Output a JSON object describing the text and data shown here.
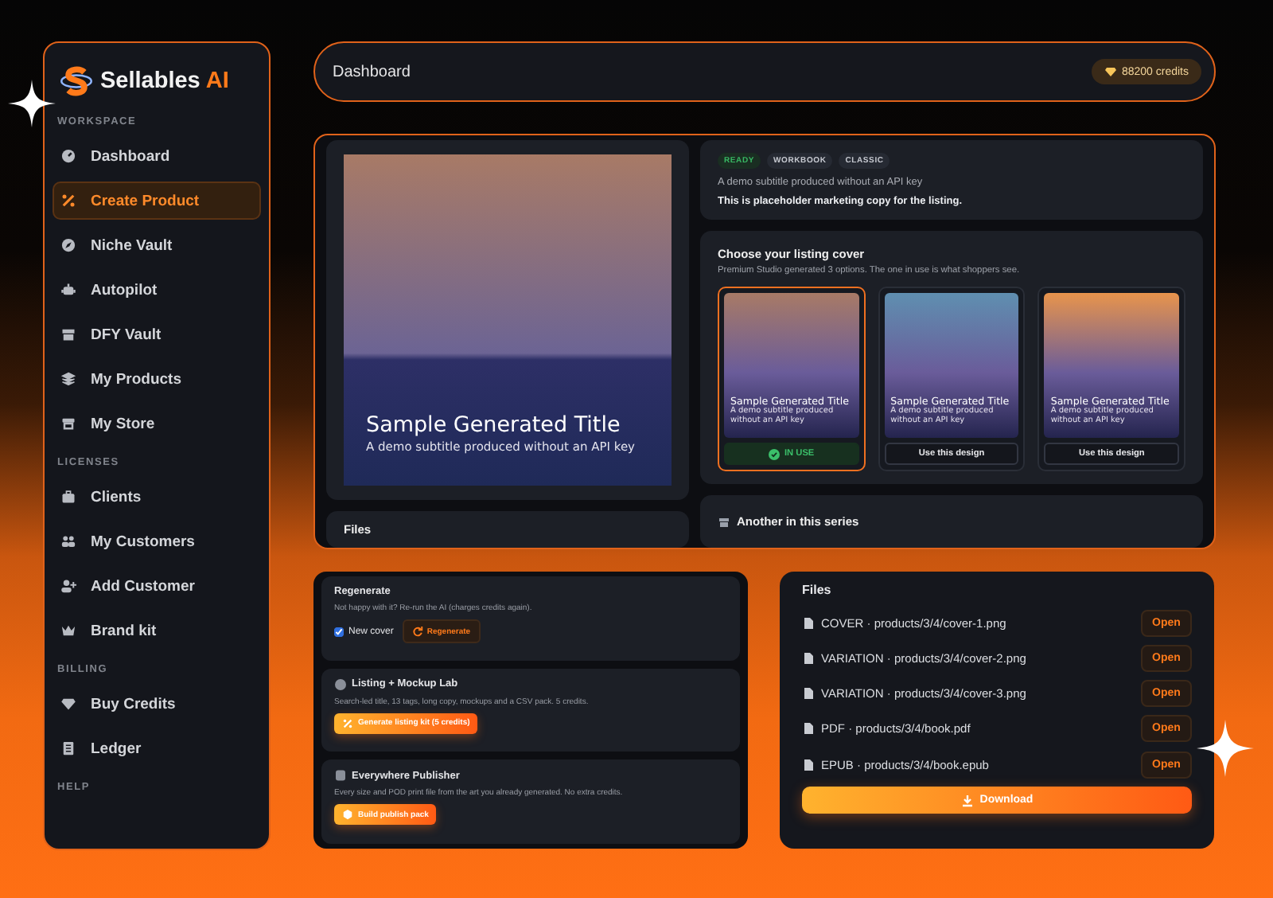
{
  "brand": {
    "name": "Sellables",
    "suffix": "AI"
  },
  "sidebar": {
    "sections": [
      {
        "heading": "WORKSPACE",
        "items": [
          {
            "label": "Dashboard",
            "selected": false
          },
          {
            "label": "Create Product",
            "selected": true
          },
          {
            "label": "Niche Vault",
            "selected": false
          },
          {
            "label": "Autopilot",
            "selected": false
          },
          {
            "label": "DFY Vault",
            "selected": false
          },
          {
            "label": "My Products",
            "selected": false
          },
          {
            "label": "My Store",
            "selected": false
          }
        ]
      },
      {
        "heading": "LICENSES",
        "items": [
          {
            "label": "Clients",
            "selected": false
          },
          {
            "label": "My Customers",
            "selected": false
          },
          {
            "label": "Add Customer",
            "selected": false
          },
          {
            "label": "Brand kit",
            "selected": false
          }
        ]
      },
      {
        "heading": "BILLING",
        "items": [
          {
            "label": "Buy Credits",
            "selected": false
          },
          {
            "label": "Ledger",
            "selected": false
          }
        ]
      },
      {
        "heading": "HELP"
      }
    ]
  },
  "header": {
    "title": "Dashboard",
    "credits": "88200 credits"
  },
  "preview": {
    "title": "Sample Generated Title",
    "subtitle": "A demo subtitle produced without an API key"
  },
  "preview_files": {
    "title": "Files"
  },
  "info": {
    "tags": [
      {
        "label": "READY",
        "kind": "status"
      },
      {
        "label": "WORKBOOK",
        "kind": "plain"
      },
      {
        "label": "CLASSIC",
        "kind": "plain"
      }
    ],
    "subtitle": "A demo subtitle produced without an API key",
    "copy": "This is placeholder marketing copy for the listing."
  },
  "cover_picker": {
    "title": "Choose your listing cover",
    "description": "Premium Studio generated 3 options. The one in use is what shoppers see.",
    "covers": [
      {
        "title": "Sample Generated Title",
        "subtitle": "A demo subtitle produced without an API key",
        "color": "#a87a66",
        "selected": true,
        "action": "IN USE"
      },
      {
        "title": "Sample Generated Title",
        "subtitle": "A demo subtitle produced without an API key",
        "color": "#5f8fb0",
        "selected": false,
        "action": "Use this design"
      },
      {
        "title": "Sample Generated Title",
        "subtitle": "A demo subtitle produced without an API key",
        "color": "#e8944c",
        "selected": false,
        "action": "Use this design"
      }
    ]
  },
  "series": {
    "title": "Another in this series"
  },
  "regenerate": {
    "title": "Regenerate",
    "description": "Not happy with it? Re-run the AI (charges credits again).",
    "option": {
      "label": "New cover",
      "checked": true
    },
    "button": "Regenerate"
  },
  "tools": [
    {
      "title": "Listing + Mockup Lab",
      "description": "Search-led title, 13 tags, long copy, mockups and a CSV pack. 5 credits.",
      "button": "Generate listing kit (5 credits)"
    },
    {
      "title": "Everywhere Publisher",
      "description": "Every size and POD print file from the art you already generated. No extra credits.",
      "button": "Build publish pack"
    }
  ],
  "files": {
    "title": "Files",
    "items": [
      {
        "label": "COVER · products/3/4/cover-1.png",
        "action": "Open"
      },
      {
        "label": "VARIATION · products/3/4/cover-2.png",
        "action": "Open"
      },
      {
        "label": "VARIATION · products/3/4/cover-3.png",
        "action": "Open"
      },
      {
        "label": "PDF · products/3/4/book.pdf",
        "action": "Open"
      },
      {
        "label": "EPUB · products/3/4/book.epub",
        "action": "Open"
      }
    ],
    "download": "Download"
  }
}
